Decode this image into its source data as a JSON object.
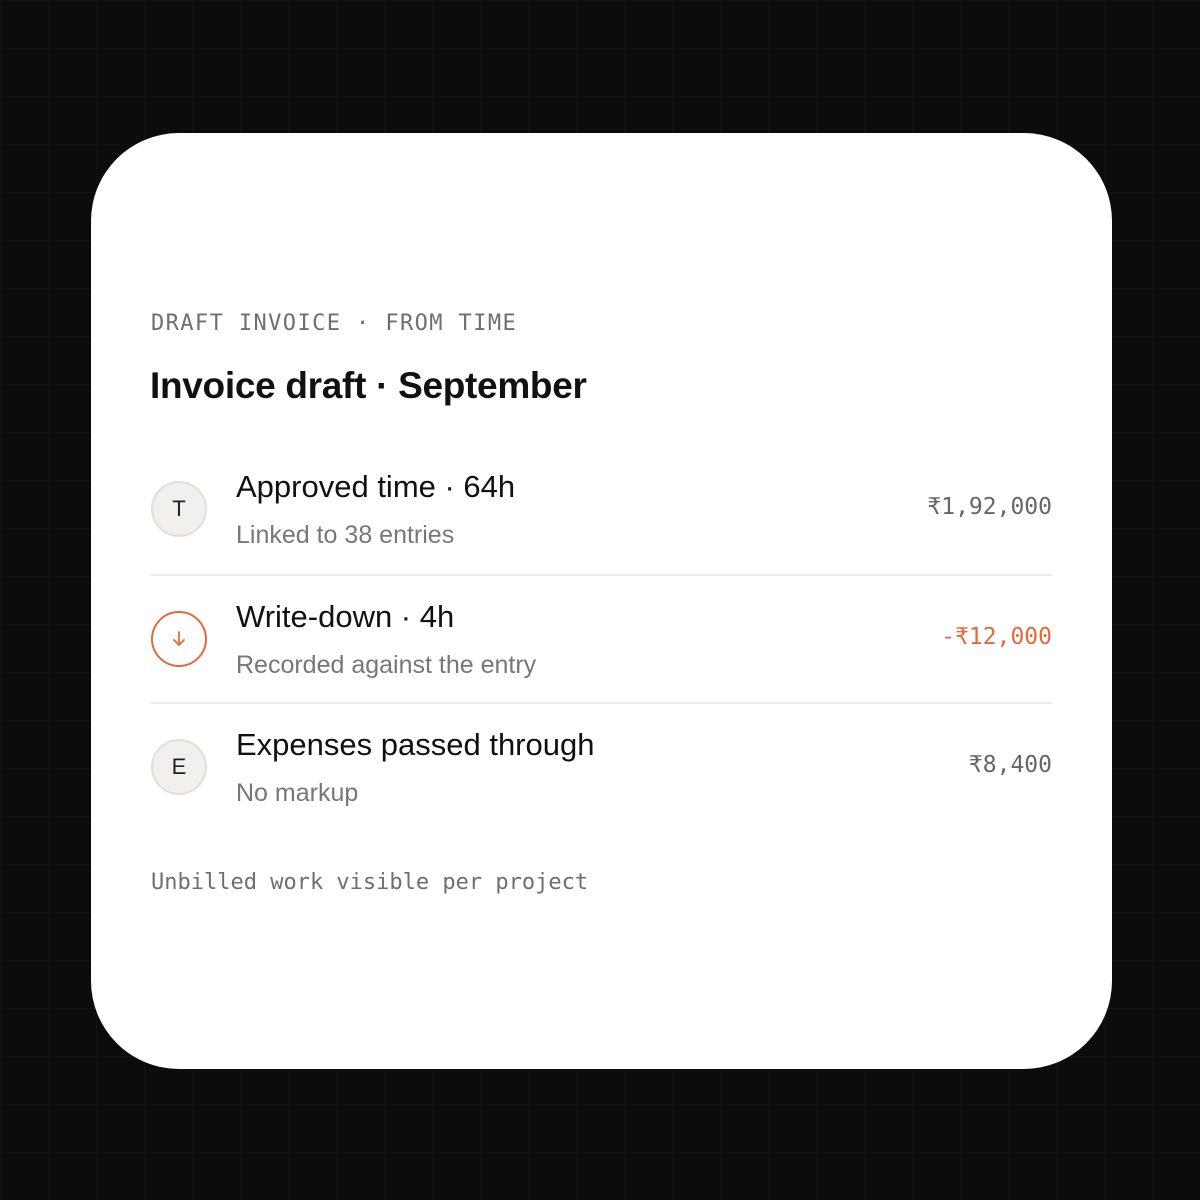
{
  "card": {
    "eyebrow": "DRAFT INVOICE · FROM TIME",
    "title": "Invoice draft · September",
    "lines": [
      {
        "badge": "T",
        "icon": "letter-badge",
        "title": "Approved time · 64h",
        "subtitle": "Linked to 38 entries",
        "amount": "₹1,92,000"
      },
      {
        "badge": "",
        "icon": "arrow-down-icon",
        "title": "Write-down · 4h",
        "subtitle": "Recorded against the entry",
        "amount": "-₹12,000"
      },
      {
        "badge": "E",
        "icon": "letter-badge",
        "title": "Expenses passed through",
        "subtitle": "No markup",
        "amount": "₹8,400"
      }
    ],
    "footer": "Unbilled work visible per project"
  },
  "colors": {
    "background": "#0c0c0d",
    "card": "#ffffff",
    "accent_negative": "#e46a3c",
    "muted_text": "#777777"
  }
}
